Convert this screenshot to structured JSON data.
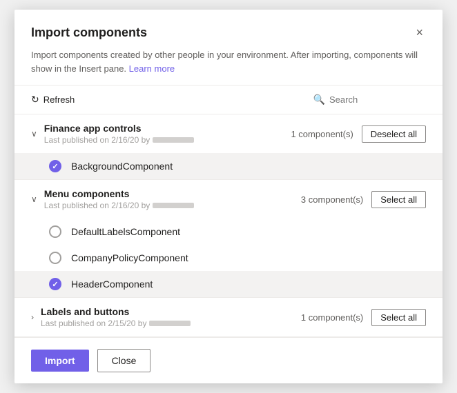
{
  "dialog": {
    "title": "Import components",
    "description": "Import components created by other people in your environment. After importing, components will show in the Insert pane.",
    "learn_more_label": "Learn more",
    "close_label": "×"
  },
  "toolbar": {
    "refresh_label": "Refresh",
    "search_placeholder": "Search"
  },
  "groups": [
    {
      "id": "finance-app",
      "name": "Finance app controls",
      "meta_published": "Last published on 2/16/20 by",
      "component_count": "1 component(s)",
      "action_label": "Deselect all",
      "action_type": "deselect",
      "expanded": true,
      "components": [
        {
          "id": "bg-comp",
          "label": "BackgroundComponent",
          "selected": true
        }
      ]
    },
    {
      "id": "menu-components",
      "name": "Menu components",
      "meta_published": "Last published on 2/16/20 by",
      "component_count": "3 component(s)",
      "action_label": "Select all",
      "action_type": "select",
      "expanded": true,
      "components": [
        {
          "id": "default-labels",
          "label": "DefaultLabelsComponent",
          "selected": false
        },
        {
          "id": "company-policy",
          "label": "CompanyPolicyComponent",
          "selected": false
        },
        {
          "id": "header-comp",
          "label": "HeaderComponent",
          "selected": true
        }
      ]
    },
    {
      "id": "labels-buttons",
      "name": "Labels and buttons",
      "meta_published": "Last published on 2/15/20 by",
      "component_count": "1 component(s)",
      "action_label": "Select all",
      "action_type": "select",
      "expanded": false,
      "components": []
    }
  ],
  "footer": {
    "import_label": "Import",
    "close_label": "Close"
  }
}
